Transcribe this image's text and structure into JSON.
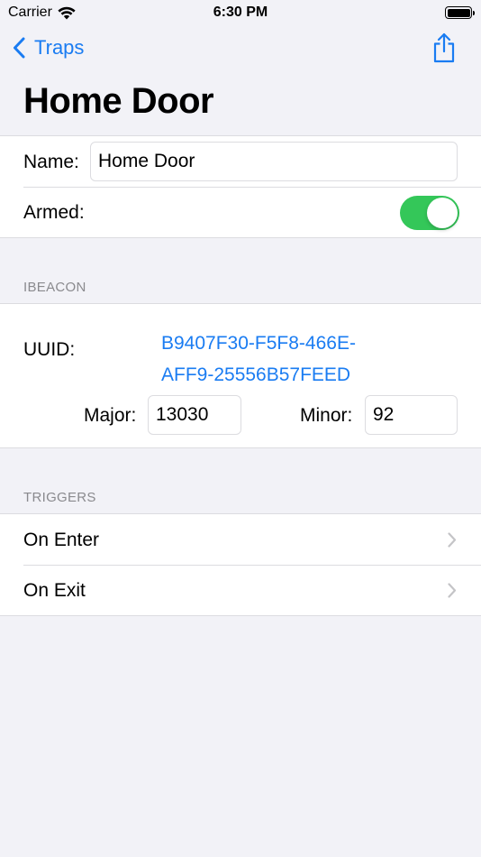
{
  "status_bar": {
    "carrier": "Carrier",
    "time": "6:30 PM"
  },
  "nav": {
    "back_label": "Traps"
  },
  "page": {
    "title": "Home Door"
  },
  "settings": {
    "name_label": "Name:",
    "name_value": "Home Door",
    "armed_label": "Armed:",
    "armed": true
  },
  "ibeacon": {
    "header": "IBEACON",
    "uuid_label": "UUID:",
    "uuid_line1": "B9407F30-F5F8-466E-",
    "uuid_line2": "AFF9-25556B57FEED",
    "major_label": "Major:",
    "major_value": "13030",
    "minor_label": "Minor:",
    "minor_value": "92"
  },
  "triggers": {
    "header": "TRIGGERS",
    "items": [
      {
        "label": "On Enter"
      },
      {
        "label": "On Exit"
      }
    ]
  },
  "colors": {
    "accent": "#1a7cf2",
    "toggle_on": "#34c759",
    "background": "#f2f2f7",
    "section_text": "#8a8a8e"
  }
}
